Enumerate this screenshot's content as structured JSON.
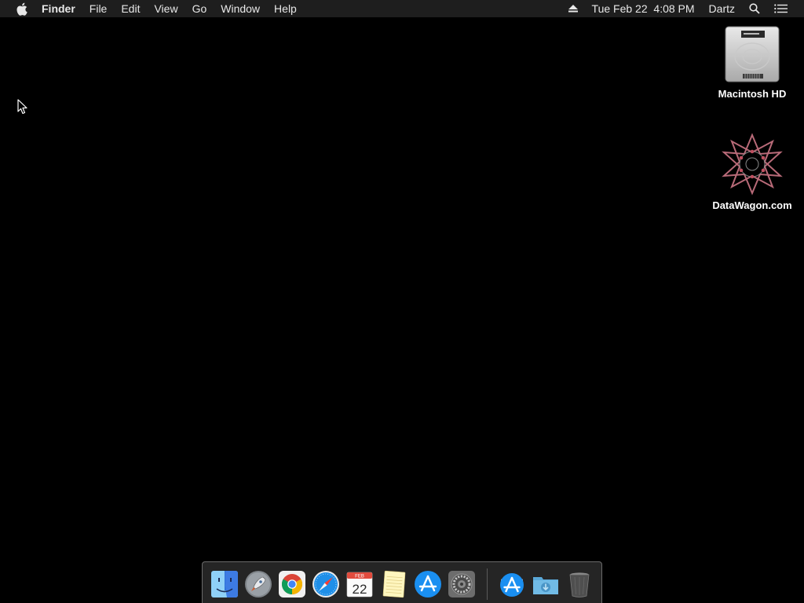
{
  "menubar": {
    "apple_icon": "apple-logo-icon",
    "app_name": "Finder",
    "menus": [
      "File",
      "Edit",
      "View",
      "Go",
      "Window",
      "Help"
    ],
    "status": {
      "eject_icon": "eject-icon",
      "clock": "Tue Feb 22  4:08 PM",
      "user": "Dartz",
      "search_icon": "spotlight-search-icon",
      "notification_icon": "notification-center-icon"
    }
  },
  "desktop": {
    "background": "#000000",
    "icons": [
      {
        "label": "Macintosh HD",
        "icon": "hard-drive-icon"
      },
      {
        "label": "DataWagon.com",
        "icon": "network-volume-icon"
      }
    ]
  },
  "dock": {
    "apps": [
      {
        "name": "Finder",
        "icon": "finder-icon",
        "running": true
      },
      {
        "name": "Launchpad",
        "icon": "launchpad-icon",
        "running": false
      },
      {
        "name": "Google Chrome",
        "icon": "chrome-icon",
        "running": true
      },
      {
        "name": "Safari",
        "icon": "safari-icon",
        "running": false
      },
      {
        "name": "Calendar",
        "icon": "calendar-icon",
        "running": false,
        "month": "FEB",
        "day": "22"
      },
      {
        "name": "Notes",
        "icon": "notes-icon",
        "running": false
      },
      {
        "name": "App Store",
        "icon": "app-store-icon",
        "running": false
      },
      {
        "name": "System Preferences",
        "icon": "system-preferences-icon",
        "running": false
      }
    ],
    "others": [
      {
        "name": "Applications",
        "icon": "applications-stack-icon"
      },
      {
        "name": "Downloads",
        "icon": "downloads-folder-icon"
      },
      {
        "name": "Trash",
        "icon": "trash-icon"
      }
    ]
  },
  "colors": {
    "menubar_bg": "#1e1e1e",
    "menubar_text": "#e8e8e8",
    "dock_border": "#6b6b6b"
  }
}
